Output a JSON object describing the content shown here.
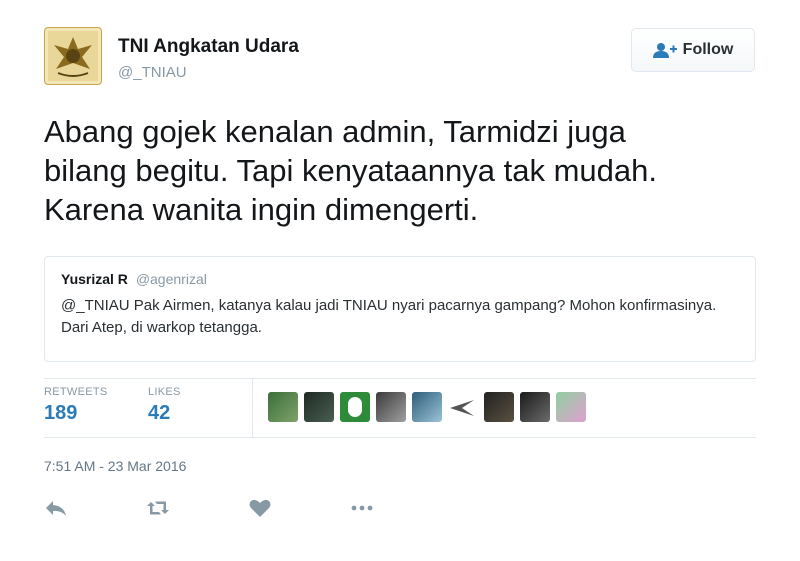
{
  "tweet": {
    "display_name": "TNI Angkatan Udara",
    "handle": "@_TNIAU",
    "follow_label": "Follow",
    "text": "Abang gojek kenalan admin, Tarmidzi juga\nbilang begitu. Tapi kenyataannya tak mudah.\nKarena wanita ingin dimengerti.",
    "quoted": {
      "name": "Yusrizal R",
      "handle": "@agenrizal",
      "text": "@_TNIAU Pak Airmen, katanya kalau jadi TNIAU nyari pacarnya gampang? Mohon konfirmasinya. Dari Atep, di warkop tetangga."
    },
    "stats": {
      "retweets_label": "RETWEETS",
      "retweets_count": "189",
      "likes_label": "LIKES",
      "likes_count": "42"
    },
    "timestamp": "7:51 AM - 23 Mar 2016",
    "icons": {
      "reply": "reply-icon",
      "retweet": "retweet-icon",
      "like": "heart-icon",
      "more": "more-icon",
      "follow": "add-user-icon"
    },
    "colors": {
      "link": "#2b7bb9",
      "muted": "#8899a6",
      "border": "#e1e8ed"
    }
  }
}
